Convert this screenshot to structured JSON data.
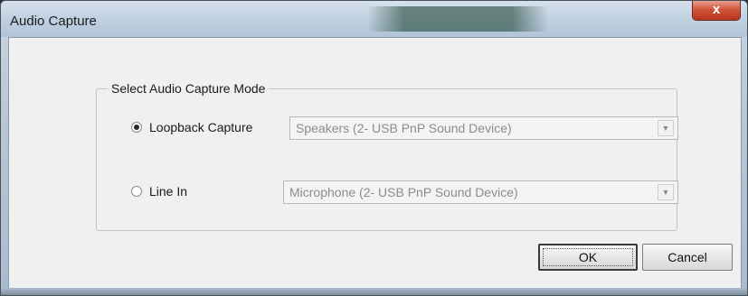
{
  "window": {
    "title": "Audio Capture",
    "close_glyph": "x"
  },
  "group": {
    "legend": "Select Audio Capture Mode"
  },
  "modes": [
    {
      "label": "Loopback Capture",
      "checked": true,
      "device": "Speakers (2- USB PnP Sound Device)"
    },
    {
      "label": "Line In",
      "checked": false,
      "device": "Microphone (2- USB PnP Sound Device)"
    }
  ],
  "buttons": {
    "ok": "OK",
    "cancel": "Cancel"
  },
  "icons": {
    "close": "close-icon",
    "dropdown": "chevron-down-icon"
  }
}
